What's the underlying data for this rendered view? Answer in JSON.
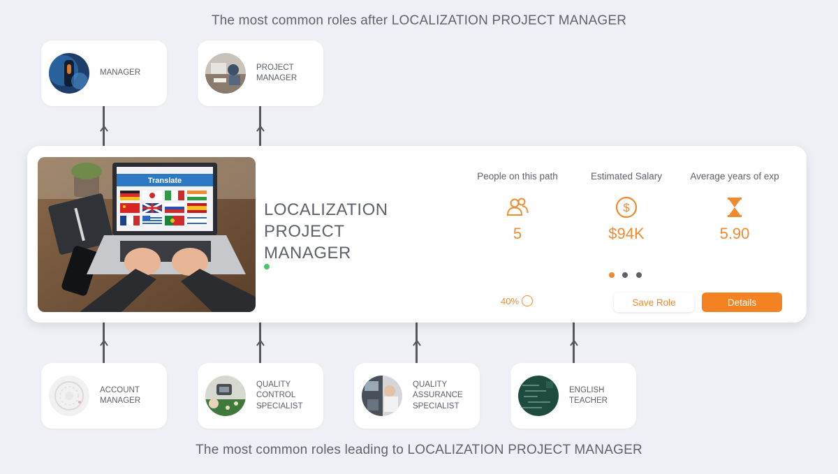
{
  "headings": {
    "top": "The most common roles after LOCALIZATION PROJECT MANAGER",
    "bottom": "The most common roles leading to LOCALIZATION PROJECT MANAGER"
  },
  "next_roles": [
    {
      "label": "MANAGER",
      "thumb": "manager-photo"
    },
    {
      "label": "PROJECT\nMANAGER",
      "thumb": "project-manager-photo"
    }
  ],
  "previous_roles": [
    {
      "label": "ACCOUNT\nMANAGER",
      "thumb": "account-manager-photo"
    },
    {
      "label": "QUALITY\nCONTROL\nSPECIALIST",
      "thumb": "quality-control-photo"
    },
    {
      "label": "QUALITY\nASSURANCE\nSPECIALIST",
      "thumb": "quality-assurance-photo"
    },
    {
      "label": "ENGLISH\nTEACHER",
      "thumb": "english-teacher-photo"
    }
  ],
  "main_role": {
    "title": "LOCALIZATION\nPROJECT\nMANAGER",
    "image_banner_text": "Translate",
    "stats": {
      "people": {
        "label": "People on this path",
        "value": "5",
        "icon": "people-icon"
      },
      "salary": {
        "label": "Estimated Salary",
        "value": "$94K",
        "icon": "dollar-circle-icon"
      },
      "experience": {
        "label": "Average years of exp",
        "value": "5.90",
        "icon": "hourglass-icon"
      }
    },
    "match_percent": "40%",
    "carousel": {
      "count": 3,
      "active_index": 0
    },
    "save_label": "Save Role",
    "details_label": "Details"
  },
  "colors": {
    "accent": "#f48222",
    "accent_text": "#f08a2e",
    "status_green": "#4cc46b",
    "background": "#eef0f6"
  }
}
